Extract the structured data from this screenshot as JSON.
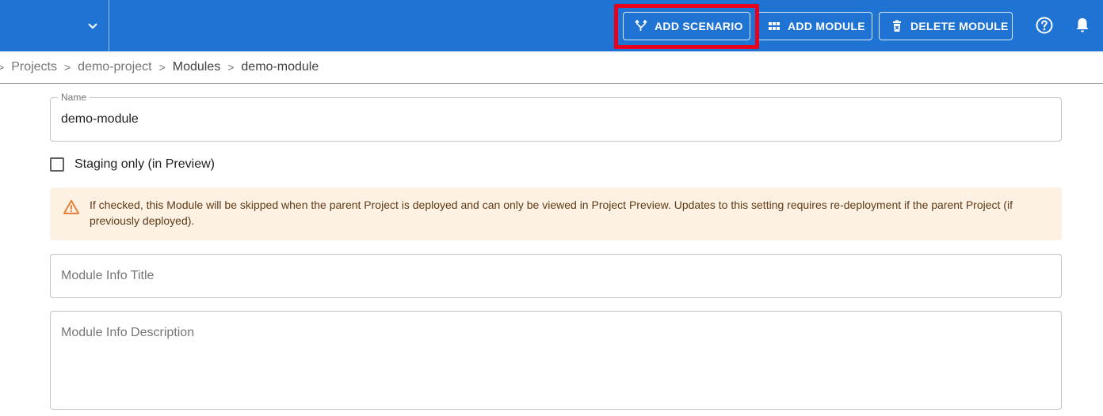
{
  "toolbar": {
    "add_scenario_label": "ADD SCENARIO",
    "add_module_label": "ADD MODULE",
    "delete_module_label": "DELETE MODULE"
  },
  "breadcrumb": {
    "items": [
      "Projects",
      "demo-project",
      "Modules",
      "demo-module"
    ],
    "separator": ">"
  },
  "form": {
    "name_label": "Name",
    "name_value": "demo-module",
    "staging_label": "Staging only (in Preview)",
    "staging_checked": false,
    "alert_text": "If checked, this Module will be skipped when the parent Project is deployed and can only be viewed in Project Preview. Updates to this setting requires re-deployment if the parent Project (if previously deployed).",
    "info_title_placeholder": "Module Info Title",
    "info_description_placeholder": "Module Info Description"
  },
  "colors": {
    "topbar": "#1f73d2",
    "highlight": "#e8001c",
    "alert_background": "#fdf1e4",
    "alert_icon": "#e8772e"
  },
  "icons": [
    "chevron-down-icon",
    "scenario-branch-icon",
    "grid-icon",
    "delete-icon",
    "help-icon",
    "bell-icon",
    "warning-icon"
  ]
}
